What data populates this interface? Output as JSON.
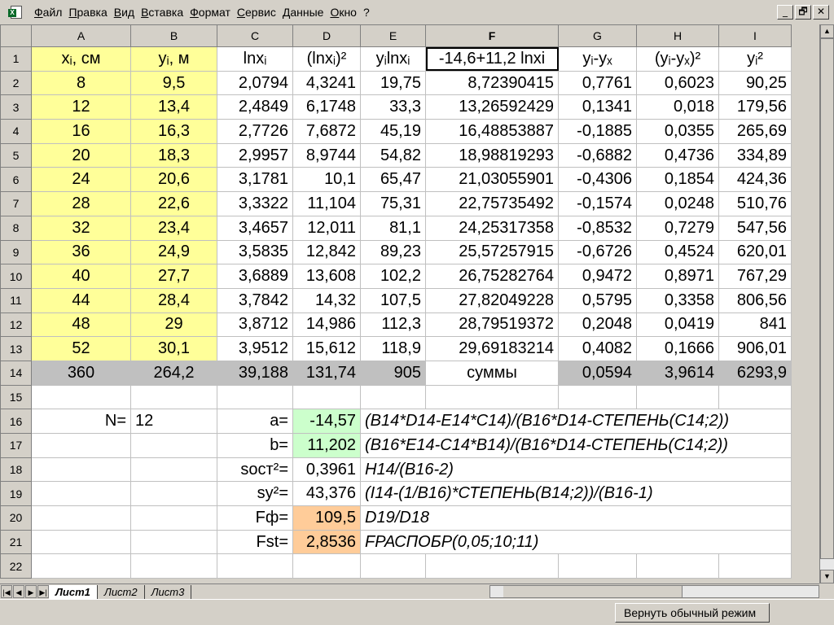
{
  "menu": [
    "Файл",
    "Правка",
    "Вид",
    "Вставка",
    "Формат",
    "Сервис",
    "Данные",
    "Окно",
    "?"
  ],
  "window_buttons": [
    "_",
    "🗗",
    "✕"
  ],
  "columns": [
    "A",
    "B",
    "C",
    "D",
    "E",
    "F",
    "G",
    "H",
    "I"
  ],
  "rows": [
    {
      "n": "1",
      "cells": [
        "xᵢ, см",
        "yᵢ, м",
        "lnxᵢ",
        "(lnxᵢ)²",
        "yᵢlnxᵢ",
        "-14,6+11,2 lnxi",
        "yᵢ-yₓ",
        "(yᵢ-yₓ)²",
        "yᵢ²"
      ]
    },
    {
      "n": "2",
      "cells": [
        "8",
        "9,5",
        "2,0794",
        "4,3241",
        "19,75",
        "8,72390415",
        "0,7761",
        "0,6023",
        "90,25"
      ]
    },
    {
      "n": "3",
      "cells": [
        "12",
        "13,4",
        "2,4849",
        "6,1748",
        "33,3",
        "13,26592429",
        "0,1341",
        "0,018",
        "179,56"
      ]
    },
    {
      "n": "4",
      "cells": [
        "16",
        "16,3",
        "2,7726",
        "7,6872",
        "45,19",
        "16,48853887",
        "-0,1885",
        "0,0355",
        "265,69"
      ]
    },
    {
      "n": "5",
      "cells": [
        "20",
        "18,3",
        "2,9957",
        "8,9744",
        "54,82",
        "18,98819293",
        "-0,6882",
        "0,4736",
        "334,89"
      ]
    },
    {
      "n": "6",
      "cells": [
        "24",
        "20,6",
        "3,1781",
        "10,1",
        "65,47",
        "21,03055901",
        "-0,4306",
        "0,1854",
        "424,36"
      ]
    },
    {
      "n": "7",
      "cells": [
        "28",
        "22,6",
        "3,3322",
        "11,104",
        "75,31",
        "22,75735492",
        "-0,1574",
        "0,0248",
        "510,76"
      ]
    },
    {
      "n": "8",
      "cells": [
        "32",
        "23,4",
        "3,4657",
        "12,011",
        "81,1",
        "24,25317358",
        "-0,8532",
        "0,7279",
        "547,56"
      ]
    },
    {
      "n": "9",
      "cells": [
        "36",
        "24,9",
        "3,5835",
        "12,842",
        "89,23",
        "25,57257915",
        "-0,6726",
        "0,4524",
        "620,01"
      ]
    },
    {
      "n": "10",
      "cells": [
        "40",
        "27,7",
        "3,6889",
        "13,608",
        "102,2",
        "26,75282764",
        "0,9472",
        "0,8971",
        "767,29"
      ]
    },
    {
      "n": "11",
      "cells": [
        "44",
        "28,4",
        "3,7842",
        "14,32",
        "107,5",
        "27,82049228",
        "0,5795",
        "0,3358",
        "806,56"
      ]
    },
    {
      "n": "12",
      "cells": [
        "48",
        "29",
        "3,8712",
        "14,986",
        "112,3",
        "28,79519372",
        "0,2048",
        "0,0419",
        "841"
      ]
    },
    {
      "n": "13",
      "cells": [
        "52",
        "30,1",
        "3,9512",
        "15,612",
        "118,9",
        "29,69183214",
        "0,4082",
        "0,1666",
        "906,01"
      ]
    },
    {
      "n": "14",
      "cells": [
        "360",
        "264,2",
        "39,188",
        "131,74",
        "905",
        "суммы",
        "0,0594",
        "3,9614",
        "6293,9"
      ]
    },
    {
      "n": "15",
      "cells": [
        "",
        "",
        "",
        "",
        "",
        "",
        "",
        "",
        ""
      ]
    },
    {
      "n": "16",
      "cells": [
        "N=",
        "12",
        "a=",
        "-14,57",
        "(B14*D14-E14*C14)/(B16*D14-СТЕПЕНЬ(C14;2))",
        "",
        "",
        "",
        ""
      ]
    },
    {
      "n": "17",
      "cells": [
        "",
        "",
        "b=",
        "11,202",
        "(B16*E14-C14*B14)/(B16*D14-СТЕПЕНЬ(C14;2))",
        "",
        "",
        "",
        ""
      ]
    },
    {
      "n": "18",
      "cells": [
        "",
        "",
        "sост²=",
        "0,3961",
        "H14/(B16-2)",
        "",
        "",
        "",
        ""
      ]
    },
    {
      "n": "19",
      "cells": [
        "",
        "",
        "sy²=",
        "43,376",
        "(I14-(1/B16)*СТЕПЕНЬ(B14;2))/(B16-1)",
        "",
        "",
        "",
        ""
      ]
    },
    {
      "n": "20",
      "cells": [
        "",
        "",
        "Fф=",
        "109,5",
        "D19/D18",
        "",
        "",
        "",
        ""
      ]
    },
    {
      "n": "21",
      "cells": [
        "",
        "",
        "Fst=",
        "2,8536",
        "FРАСПОБР(0,05;10;11)",
        "",
        "",
        "",
        ""
      ]
    },
    {
      "n": "22",
      "cells": [
        "",
        "",
        "",
        "",
        "",
        "",
        "",
        "",
        ""
      ]
    }
  ],
  "sheet_tabs": [
    "Лист1",
    "Лист2",
    "Лист3"
  ],
  "nav_arrows": [
    "|◀",
    "◀",
    "▶",
    "▶|"
  ],
  "restore_button": "Вернуть обычный режим",
  "colors": {
    "yellow": "#ffff99",
    "gray": "#c0c0c0",
    "green": "#ccffcc",
    "orange": "#ffcc99"
  }
}
